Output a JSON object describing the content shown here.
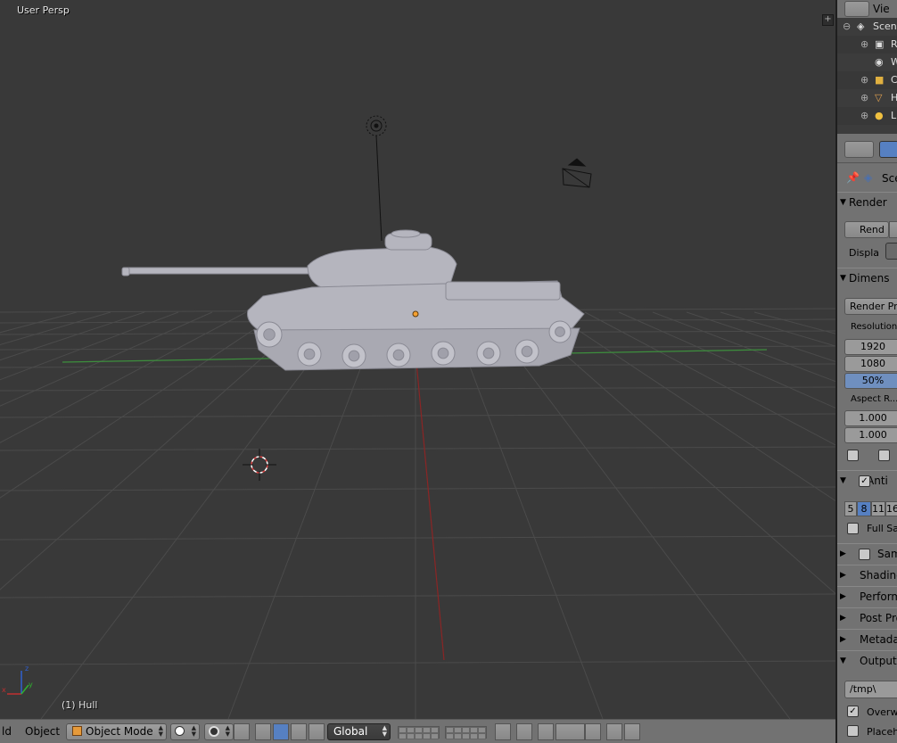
{
  "viewport": {
    "view_name": "User Persp",
    "active_object": "(1) Hull",
    "grid_color": "#4a4a4a",
    "x_axis_color": "#8b2525",
    "y_axis_color": "#3d8f3d",
    "model_color": "#b8b8c0"
  },
  "header": {
    "menu_partial": "ld",
    "object_menu": "Object",
    "mode": "Object Mode",
    "orientation": "Global"
  },
  "outliner": {
    "view_label": "Vie",
    "items": [
      {
        "label": "Scene",
        "icon": "scene-icon"
      },
      {
        "label": "R",
        "icon": "render-layers-icon"
      },
      {
        "label": "W",
        "icon": "world-icon"
      },
      {
        "label": "C",
        "icon": "camera-icon"
      },
      {
        "label": "H",
        "icon": "mesh-icon"
      },
      {
        "label": "L",
        "icon": "lamp-icon"
      }
    ]
  },
  "properties": {
    "context_label": "Sce",
    "render_panel": "Render",
    "render_button": "Rend",
    "display_label": "Displa",
    "dimensions_panel": "Dimens",
    "render_presets": "Render Pre",
    "resolution_label": "Resolution:",
    "res_x": "1920",
    "res_y": "1080",
    "res_pct": "50%",
    "aspect_label": "Aspect R...",
    "aspect_x": "1.000",
    "aspect_y": "1.000",
    "aa_panel": "Anti",
    "aa_samples": [
      "5",
      "8",
      "11",
      "16"
    ],
    "aa_selected": "8",
    "full_sample": "Full Sa",
    "sampled_motion": "Sam",
    "shading_panel": "Shading",
    "performance_panel": "Perform",
    "post_processing_panel": "Post Pro",
    "metadata_panel": "Metadat",
    "output_panel": "Output",
    "output_path": "/tmp\\",
    "overwrite": "Overw",
    "placeholders": "Placeh"
  }
}
